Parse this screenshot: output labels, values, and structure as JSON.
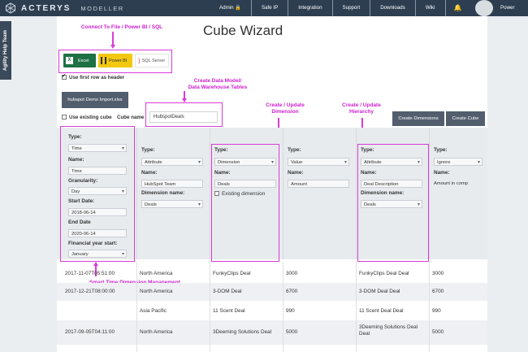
{
  "brand": {
    "name": "ACTERYS",
    "sub": "MODELLER"
  },
  "nav": [
    "Admin 🔒",
    "Safe IP",
    "Integration",
    "Support",
    "Downloads",
    "Wiki"
  ],
  "user": {
    "name": "Power"
  },
  "side_tab": "Agility Help Team",
  "title": "Cube Wizard",
  "annotations": {
    "connect": "Connect To File / Power BI / SQL",
    "data_model": "Create Data Model/\nData Warehouse Tables",
    "dimension": "Create / Update\nDimension",
    "hierarchy": "Create / Update\nHierarchy",
    "smart_time": "Smart Time Dimension Management"
  },
  "sources": {
    "excel": "Excel",
    "pbi": "Power BI",
    "sql": "SQL Server"
  },
  "first_row_label": "Use first row as header",
  "import_button": "hubspot Demo Import.xlsx",
  "use_existing_label": "Use existing cube",
  "cube_name_label": "Cube name",
  "cube_name_value": "HubspotDeals",
  "buttons": {
    "create_dimensions": "Create Dimensions",
    "create_cube": "Create Cube"
  },
  "columns": {
    "c1": {
      "type_lbl": "Type:",
      "type": "Time",
      "name_lbl": "Name:",
      "name": "Time",
      "gran_lbl": "Granularity:",
      "gran": "Day",
      "start_lbl": "Start Date:",
      "start": "2018-06-14",
      "end_lbl": "End Date",
      "end": "2020-06-14",
      "fy_lbl": "Financial year start:",
      "fy": "January"
    },
    "c2": {
      "type_lbl": "Type:",
      "type": "Attribute",
      "name_lbl": "Name:",
      "name": "HubSpot Team",
      "dim_lbl": "Dimension name:",
      "dim": "Deals"
    },
    "c3": {
      "type_lbl": "Type:",
      "type": "Dimension",
      "name_lbl": "Name:",
      "name": "Deals",
      "existing": "Existing dimension"
    },
    "c4": {
      "type_lbl": "Type:",
      "type": "Value",
      "name_lbl": "Name:",
      "name": "Amount"
    },
    "c5": {
      "type_lbl": "Type:",
      "type": "Attribute",
      "name_lbl": "Name:",
      "name": "Deal Description",
      "dim_lbl": "Dimension name:",
      "dim": "Deals"
    },
    "c6": {
      "type_lbl": "Type:",
      "type": "Ignore",
      "name_lbl": "Name:",
      "name": "Amount in comp"
    }
  },
  "rows": [
    {
      "date": "2017-11-07T05:51:00",
      "region": "North America",
      "deal": "FunkyClips Deal",
      "amount": "3000",
      "desc": "FunkyClips Deal Deal",
      "amt2": "3000"
    },
    {
      "date": "2017-12-21T08:00:00",
      "region": "North America",
      "deal": "3-DOM Deal",
      "amount": "6700",
      "desc": "3-DOM Deal Deal",
      "amt2": "6700"
    },
    {
      "date": "",
      "region": "Asia Pacific",
      "deal": "11 Scent Deal",
      "amount": "990",
      "desc": "11 Scent Deal Deal",
      "amt2": "990"
    },
    {
      "date": "2017-09-05T04:11:00",
      "region": "North America",
      "deal": "3Deeming Solutions Deal",
      "amount": "5000",
      "desc": "3Deeming Solutions Deal Deal",
      "amt2": "5000"
    }
  ]
}
